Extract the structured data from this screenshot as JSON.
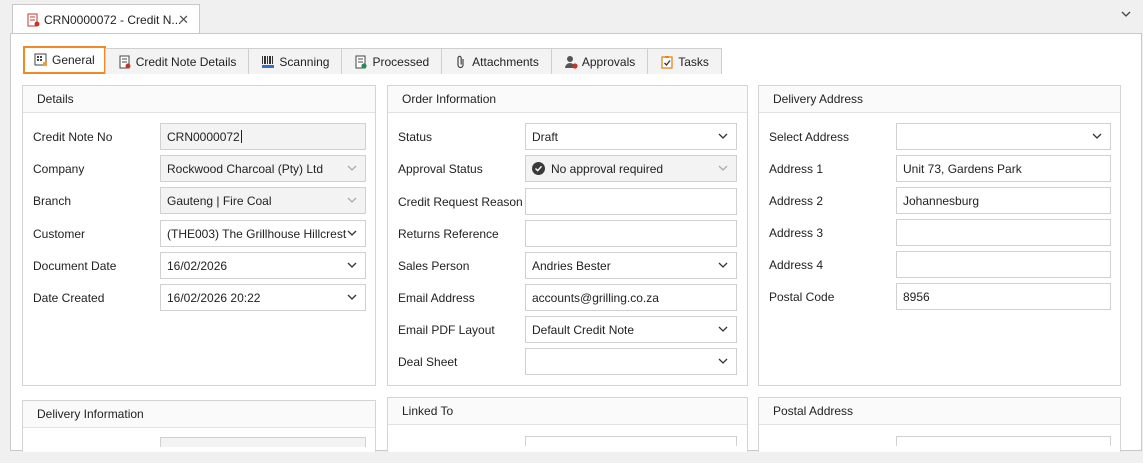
{
  "document_tab": {
    "title": "CRN0000072 - Credit N...",
    "close": "✕"
  },
  "tabs": [
    {
      "label": "General",
      "icon": "general-grid-icon"
    },
    {
      "label": "Credit Note Details",
      "icon": "document-pencil-icon"
    },
    {
      "label": "Scanning",
      "icon": "barcode-icon"
    },
    {
      "label": "Processed",
      "icon": "processed-doc-icon"
    },
    {
      "label": "Attachments",
      "icon": "paperclip-icon"
    },
    {
      "label": "Approvals",
      "icon": "user-approval-icon"
    },
    {
      "label": "Tasks",
      "icon": "clipboard-check-icon"
    }
  ],
  "details": {
    "header": "Details",
    "credit_note_no_label": "Credit Note No",
    "credit_note_no": "CRN0000072",
    "company_label": "Company",
    "company": "Rockwood Charcoal (Pty) Ltd",
    "branch_label": "Branch",
    "branch": "Gauteng | Fire Coal",
    "customer_label": "Customer",
    "customer": "(THE003) The Grillhouse Hillcrest",
    "document_date_label": "Document Date",
    "document_date": "16/02/2026",
    "date_created_label": "Date Created",
    "date_created": "16/02/2026 20:22"
  },
  "order_info": {
    "header": "Order Information",
    "status_label": "Status",
    "status": "Draft",
    "approval_status_label": "Approval Status",
    "approval_status": "No approval required",
    "credit_request_reason_label": "Credit Request Reason",
    "credit_request_reason": "",
    "returns_reference_label": "Returns Reference",
    "returns_reference": "",
    "sales_person_label": "Sales Person",
    "sales_person": "Andries Bester",
    "email_address_label": "Email Address",
    "email_address": "accounts@grilling.co.za",
    "email_pdf_layout_label": "Email PDF Layout",
    "email_pdf_layout": "Default Credit Note",
    "deal_sheet_label": "Deal Sheet",
    "deal_sheet": ""
  },
  "delivery_address": {
    "header": "Delivery Address",
    "select_address_label": "Select Address",
    "select_address": "",
    "address1_label": "Address 1",
    "address1": "Unit 73, Gardens Park",
    "address2_label": "Address 2",
    "address2": "Johannesburg",
    "address3_label": "Address 3",
    "address3": "",
    "address4_label": "Address 4",
    "address4": "",
    "postal_code_label": "Postal Code",
    "postal_code": "8956"
  },
  "delivery_information": {
    "header": "Delivery Information"
  },
  "linked_to": {
    "header": "Linked To"
  },
  "postal_address": {
    "header": "Postal Address"
  },
  "colors": {
    "active_tab_border": "#f08a24"
  }
}
